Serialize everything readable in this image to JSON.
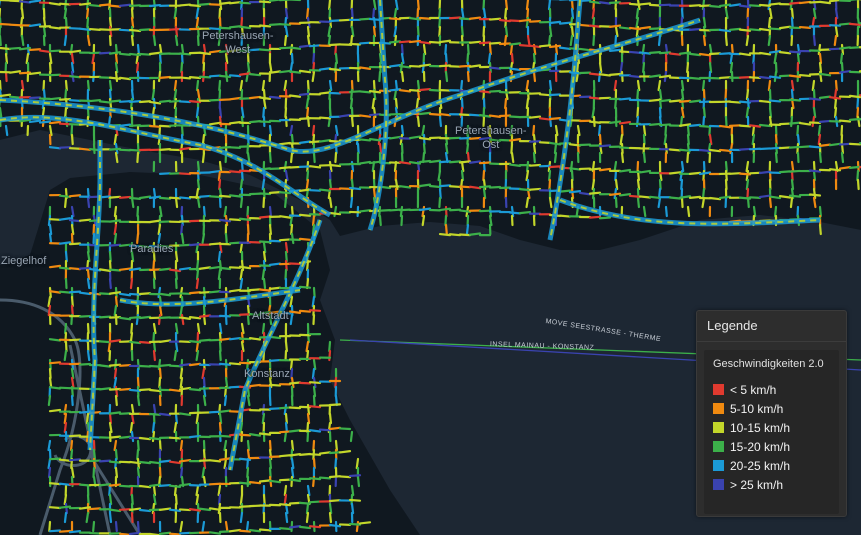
{
  "map": {
    "place_labels": [
      {
        "id": "petershausen-west",
        "text": "Petershausen-\nWest"
      },
      {
        "id": "petershausen-ost",
        "text": "Petershausen-\nOst"
      },
      {
        "id": "paradies",
        "text": "Paradies"
      },
      {
        "id": "ziegelhof",
        "text": "Ziegelhof"
      },
      {
        "id": "altstadt",
        "text": "Altstadt"
      },
      {
        "id": "konstanz",
        "text": "Konstanz"
      }
    ],
    "ferry_labels": [
      {
        "id": "move-seestrasse",
        "text": "MOVE SEESTRASSE - THERME"
      },
      {
        "id": "insel-mainau",
        "text": "INSEL MAINAU - KONSTANZ"
      }
    ]
  },
  "legend": {
    "title": "Legende",
    "subtitle": "Geschwindigkeiten 2.0",
    "items": [
      {
        "label": "< 5 km/h",
        "color": "#e03a2f"
      },
      {
        "label": "5-10 km/h",
        "color": "#f08a10"
      },
      {
        "label": "10-15 km/h",
        "color": "#c3d62a"
      },
      {
        "label": "15-20 km/h",
        "color": "#3cb04a"
      },
      {
        "label": "20-25 km/h",
        "color": "#1b9ad6"
      },
      {
        "label": "> 25 km/h",
        "color": "#3a43b0"
      }
    ]
  },
  "colors": {
    "water": "#1d2733",
    "land": "#101820",
    "road_base": "#3a4a58",
    "ferry_line_green": "#3cb04a",
    "ferry_line_blue": "#3a43b0"
  }
}
